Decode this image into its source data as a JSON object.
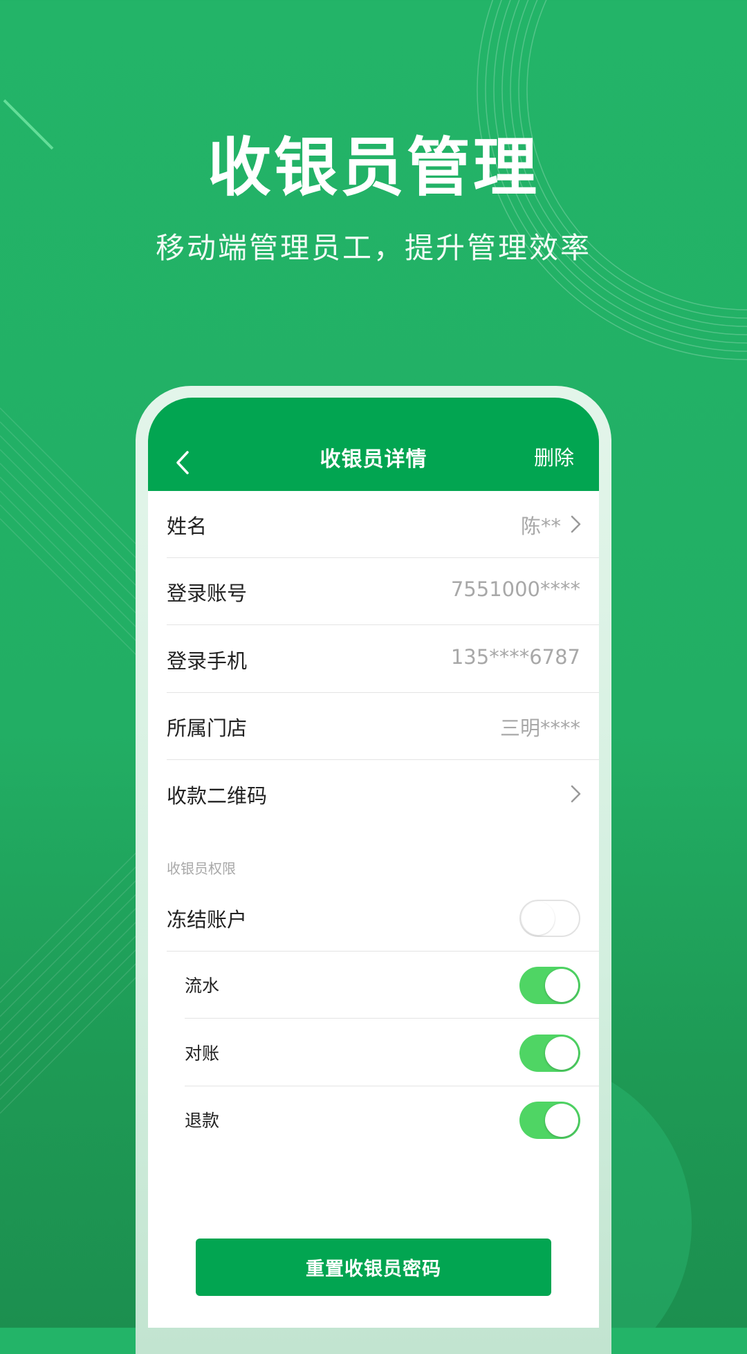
{
  "hero": {
    "title": "收银员管理",
    "subtitle": "移动端管理员工，提升管理效率"
  },
  "nav": {
    "back_icon": "chevron-left-icon",
    "title": "收银员详情",
    "delete_label": "删除"
  },
  "fields": {
    "name": {
      "label": "姓名",
      "value": "陈**"
    },
    "account": {
      "label": "登录账号",
      "value": "7551000****"
    },
    "phone": {
      "label": "登录手机",
      "value": "135****6787"
    },
    "store": {
      "label": "所属门店",
      "value": "三明****"
    },
    "qrcode": {
      "label": "收款二维码"
    }
  },
  "permissions": {
    "section_label": "收银员权限",
    "freeze": {
      "label": "冻结账户",
      "on": false
    },
    "flow": {
      "label": "流水",
      "on": true
    },
    "reconcile": {
      "label": "对账",
      "on": true
    },
    "refund": {
      "label": "退款",
      "on": true
    }
  },
  "actions": {
    "reset_password_label": "重置收银员密码"
  },
  "colors": {
    "background": "#23b468",
    "nav": "#02a551",
    "toggle_on": "#4fd564",
    "value_text": "#a8a8a8"
  }
}
